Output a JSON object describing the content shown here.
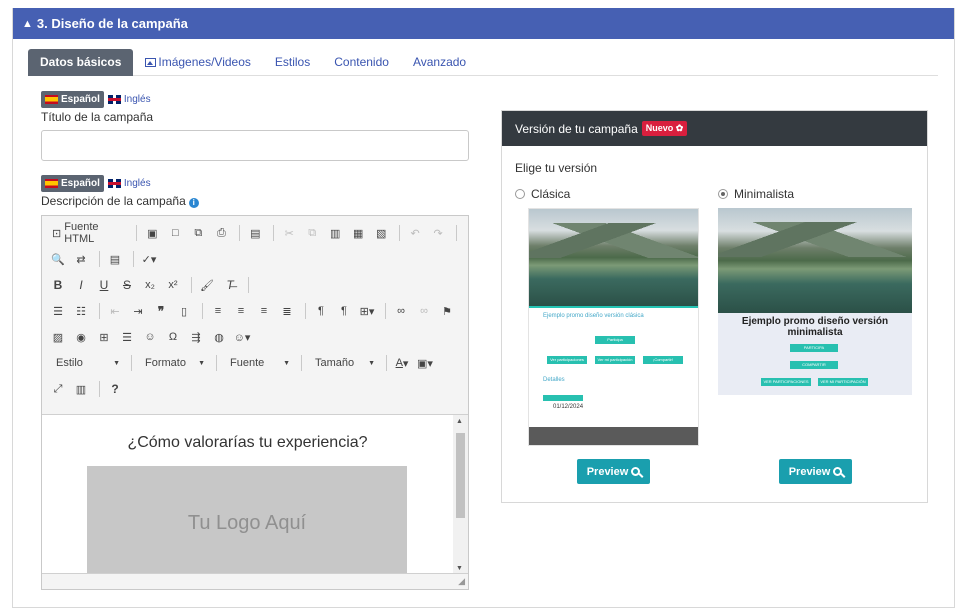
{
  "section": {
    "title": "3. Diseño de la campaña"
  },
  "tabs": [
    {
      "label": "Datos básicos"
    },
    {
      "label": "Imágenes/Videos"
    },
    {
      "label": "Estilos"
    },
    {
      "label": "Contenido"
    },
    {
      "label": "Avanzado"
    }
  ],
  "languages": {
    "es": "Español",
    "en": "Inglés"
  },
  "title_field": {
    "label": "Título de la campaña",
    "value": ""
  },
  "description_field": {
    "label": "Descripción de la campaña"
  },
  "editor": {
    "source_label": "Fuente HTML",
    "combos": {
      "style": "Estilo",
      "format": "Formato",
      "font": "Fuente",
      "size": "Tamaño"
    },
    "content_heading": "¿Cómo valorarías tu experiencia?",
    "logo_placeholder": "Tu Logo Aquí"
  },
  "version_panel": {
    "title": "Versión de tu campaña",
    "badge": "Nuevo",
    "subtitle": "Elige tu versión",
    "options": [
      {
        "label": "Clásica",
        "selected": false
      },
      {
        "label": "Minimalista",
        "selected": true
      }
    ],
    "classic_thumb": {
      "title": "Ejemplo promo diseño versión clásica",
      "btn_participa": "Participa",
      "btn_ver_part": "Ver participaciones",
      "btn_ver_mi": "Ver mi participación",
      "btn_compartir": "¡Compartir!",
      "details": "Detalles",
      "date": "01/12/2024"
    },
    "mini_thumb": {
      "title": "Ejemplo promo diseño versión minimalista",
      "btn_participa": "PARTICIPA",
      "btn_compartir": "COMPARTIR",
      "btn_ver_part": "VER PARTICIPACIONES",
      "btn_ver_mi": "VER MI PARTICIPACIÓN"
    },
    "preview_label": "Preview"
  },
  "colors": {
    "header": "#4660b3",
    "accent": "#1a9fae",
    "badge": "#d91f3e"
  }
}
